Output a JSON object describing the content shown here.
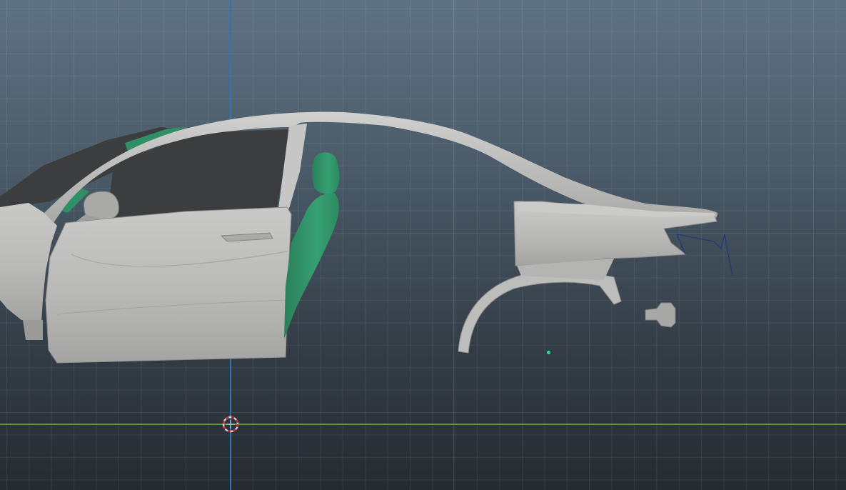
{
  "viewport": {
    "background_top": "#5f7283",
    "background_bottom": "#262b31"
  },
  "axes": {
    "y_axis_color": "#2f74b7",
    "x_axis_color": "#5b9a35"
  },
  "model": {
    "body_color": "#bdbdbc",
    "interior_color": "#2f8f66",
    "window_color": "#3c3d3e",
    "selected_edge_color": "#1a3a78"
  },
  "gizmo": {
    "ring_color": "#d6d6d6",
    "dash_color": "#c8232c"
  },
  "pivot": {
    "color": "#34d98e"
  },
  "icons": {
    "origin": "origin-manipulator-icon",
    "pivot": "pivot-point-icon"
  }
}
